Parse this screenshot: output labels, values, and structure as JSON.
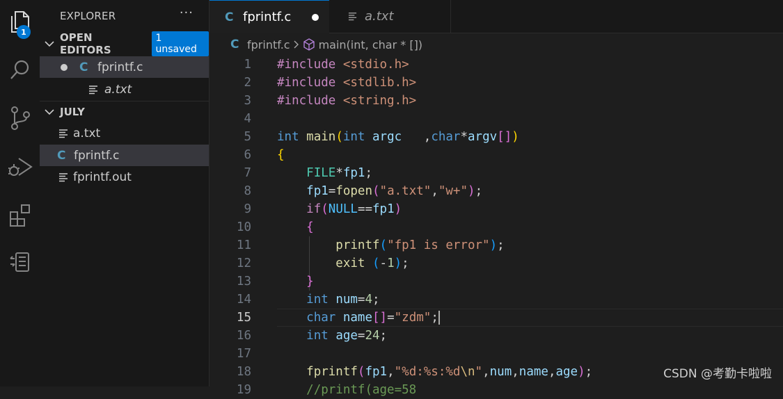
{
  "activity": {
    "explorer_badge": "1"
  },
  "sidebar": {
    "title": "EXPLORER",
    "more": "···",
    "open_editors": {
      "label": "OPEN EDITORS",
      "badge": "1 unsaved",
      "items": [
        {
          "icon": "C",
          "name": "fprintf.c"
        },
        {
          "name": "a.txt"
        }
      ]
    },
    "folder": {
      "label": "JULY",
      "items": [
        {
          "name": "a.txt"
        },
        {
          "icon": "C",
          "name": "fprintf.c"
        },
        {
          "name": "fprintf.out"
        }
      ]
    }
  },
  "tabs": [
    {
      "icon": "C",
      "name": "fprintf.c"
    },
    {
      "name": "a.txt"
    }
  ],
  "breadcrumb": {
    "file_icon": "C",
    "file": "fprintf.c",
    "symbol": "main(int, char * [])"
  },
  "editor": {
    "lines": [
      [
        [
          "pp",
          "#include "
        ],
        [
          "str",
          "<stdio.h>"
        ]
      ],
      [
        [
          "pp",
          "#include "
        ],
        [
          "str",
          "<stdlib.h>"
        ]
      ],
      [
        [
          "pp",
          "#include "
        ],
        [
          "str",
          "<string.h>"
        ]
      ],
      [],
      [
        [
          "kw",
          "int "
        ],
        [
          "fn",
          "main"
        ],
        [
          "br1",
          "("
        ],
        [
          "kw",
          "int "
        ],
        [
          "var",
          "argc "
        ],
        [
          "",
          "  ,"
        ],
        [
          "kw",
          "char"
        ],
        [
          "",
          "*"
        ],
        [
          "var",
          "argv"
        ],
        [
          "br2",
          "[]"
        ],
        [
          "br1",
          ")"
        ]
      ],
      [
        [
          "br1",
          "{"
        ]
      ],
      [
        [
          "",
          "    "
        ],
        [
          "ty",
          "FILE"
        ],
        [
          "",
          "*"
        ],
        [
          "var",
          "fp1"
        ],
        [
          "",
          ";"
        ]
      ],
      [
        [
          "",
          "    "
        ],
        [
          "var",
          "fp1"
        ],
        [
          "",
          "="
        ],
        [
          "fn",
          "fopen"
        ],
        [
          "br2",
          "("
        ],
        [
          "str",
          "\"a.txt\""
        ],
        [
          "",
          ","
        ],
        [
          "str",
          "\"w+\""
        ],
        [
          "br2",
          ")"
        ],
        [
          "",
          ";"
        ]
      ],
      [
        [
          "",
          "    "
        ],
        [
          "ctrl",
          "if"
        ],
        [
          "br2",
          "("
        ],
        [
          "const",
          "NULL"
        ],
        [
          "",
          "=="
        ],
        [
          "var",
          "fp1"
        ],
        [
          "br2",
          ")"
        ]
      ],
      [
        [
          "",
          "    "
        ],
        [
          "br2",
          "{"
        ]
      ],
      [
        [
          "",
          "        "
        ],
        [
          "fn",
          "printf"
        ],
        [
          "br3",
          "("
        ],
        [
          "str",
          "\"fp1 is error\""
        ],
        [
          "br3",
          ")"
        ],
        [
          "",
          ";"
        ]
      ],
      [
        [
          "",
          "        "
        ],
        [
          "fn",
          "exit "
        ],
        [
          "br3",
          "("
        ],
        [
          "",
          "-"
        ],
        [
          "num",
          "1"
        ],
        [
          "br3",
          ")"
        ],
        [
          "",
          ";"
        ]
      ],
      [
        [
          "",
          "    "
        ],
        [
          "br2",
          "}"
        ]
      ],
      [
        [
          "",
          "    "
        ],
        [
          "kw",
          "int "
        ],
        [
          "var",
          "num"
        ],
        [
          "",
          "="
        ],
        [
          "num",
          "4"
        ],
        [
          "",
          ";"
        ]
      ],
      [
        [
          "",
          "    "
        ],
        [
          "kw",
          "char "
        ],
        [
          "var",
          "name"
        ],
        [
          "br2",
          "[]"
        ],
        [
          "",
          "="
        ],
        [
          "str",
          "\"zdm\""
        ],
        [
          "",
          ";"
        ],
        [
          "caret",
          ""
        ]
      ],
      [
        [
          "",
          "    "
        ],
        [
          "kw",
          "int "
        ],
        [
          "var",
          "age"
        ],
        [
          "",
          "="
        ],
        [
          "num",
          "24"
        ],
        [
          "",
          ";"
        ]
      ],
      [],
      [
        [
          "",
          "    "
        ],
        [
          "fn",
          "fprintf"
        ],
        [
          "br2",
          "("
        ],
        [
          "var",
          "fp1"
        ],
        [
          "",
          ","
        ],
        [
          "str",
          "\"%d:%s:%d"
        ],
        [
          "esc",
          "\\n"
        ],
        [
          "str",
          "\""
        ],
        [
          "",
          ","
        ],
        [
          "var",
          "num"
        ],
        [
          "",
          ","
        ],
        [
          "var",
          "name"
        ],
        [
          "",
          ","
        ],
        [
          "var",
          "age"
        ],
        [
          "br2",
          ")"
        ],
        [
          "",
          ";"
        ]
      ],
      [
        [
          "",
          "    "
        ],
        [
          "cmt",
          "//printf(age=58"
        ]
      ]
    ],
    "current_line": 15
  },
  "watermark": "CSDN @考勤卡啦啦"
}
